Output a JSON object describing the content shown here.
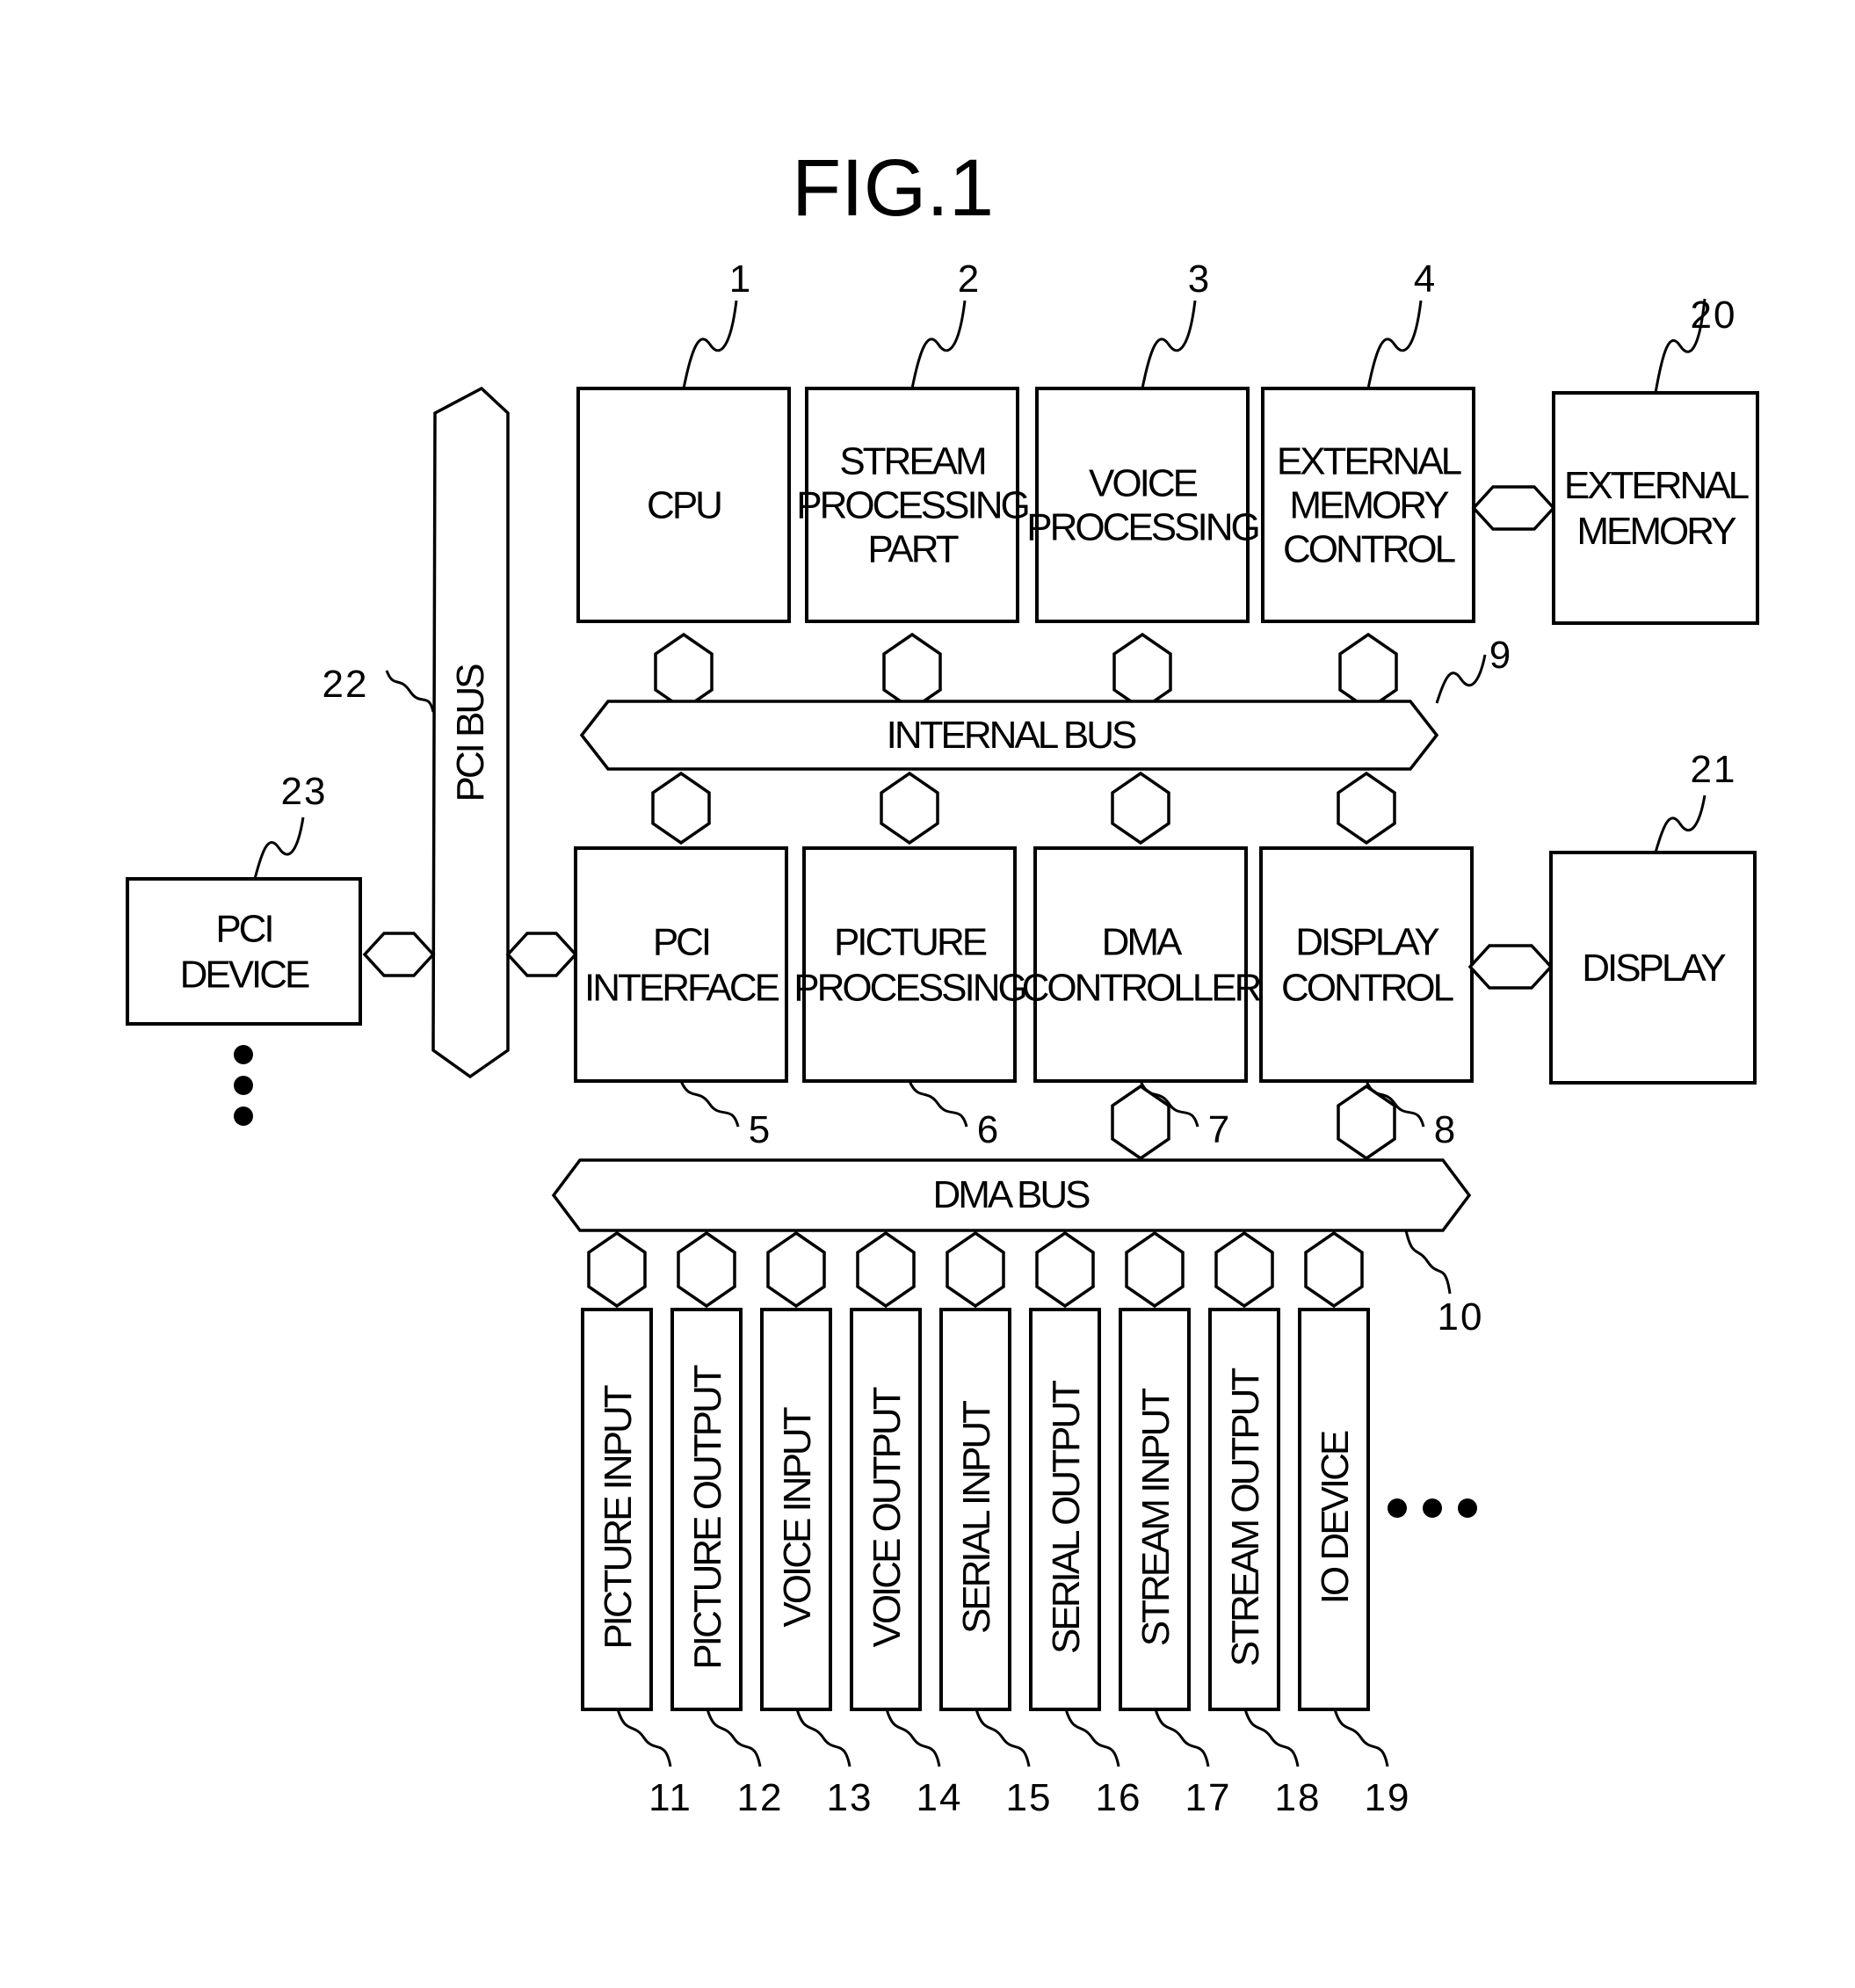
{
  "figure": {
    "title": "FIG.1"
  },
  "top_blocks": [
    {
      "ref": "1",
      "lines": [
        "CPU"
      ]
    },
    {
      "ref": "2",
      "lines": [
        "STREAM",
        "PROCESSING",
        "PART"
      ]
    },
    {
      "ref": "3",
      "lines": [
        "VOICE",
        "PROCESSING"
      ]
    },
    {
      "ref": "4",
      "lines": [
        "EXTERNAL",
        "MEMORY",
        "CONTROL"
      ]
    }
  ],
  "external_memory": {
    "ref": "20",
    "lines": [
      "EXTERNAL",
      "MEMORY"
    ]
  },
  "internal_bus": {
    "ref": "9",
    "label": "INTERNAL BUS"
  },
  "middle_blocks": [
    {
      "ref": "5",
      "lines": [
        "PCI",
        "INTERFACE"
      ]
    },
    {
      "ref": "6",
      "lines": [
        "PICTURE",
        "PROCESSING"
      ]
    },
    {
      "ref": "7",
      "lines": [
        "DMA",
        "CONTROLLER"
      ]
    },
    {
      "ref": "8",
      "lines": [
        "DISPLAY",
        "CONTROL"
      ]
    }
  ],
  "display": {
    "ref": "21",
    "lines": [
      "DISPLAY"
    ]
  },
  "pci_bus": {
    "ref": "22",
    "label": "PCI BUS"
  },
  "pci_device": {
    "ref": "23",
    "lines": [
      "PCI",
      "DEVICE"
    ],
    "continuation": "⋮"
  },
  "dma_bus": {
    "ref": "10",
    "label": "DMA BUS"
  },
  "io_blocks": [
    {
      "ref": "11",
      "label": "PICTURE INPUT"
    },
    {
      "ref": "12",
      "label": "PICTURE OUTPUT"
    },
    {
      "ref": "13",
      "label": "VOICE INPUT"
    },
    {
      "ref": "14",
      "label": "VOICE OUTPUT"
    },
    {
      "ref": "15",
      "label": "SERIAL INPUT"
    },
    {
      "ref": "16",
      "label": "SERIAL OUTPUT"
    },
    {
      "ref": "17",
      "label": "STREAM INPUT"
    },
    {
      "ref": "18",
      "label": "STREAM OUTPUT"
    },
    {
      "ref": "19",
      "label": "IO DEVICE"
    }
  ],
  "io_continuation": "…"
}
